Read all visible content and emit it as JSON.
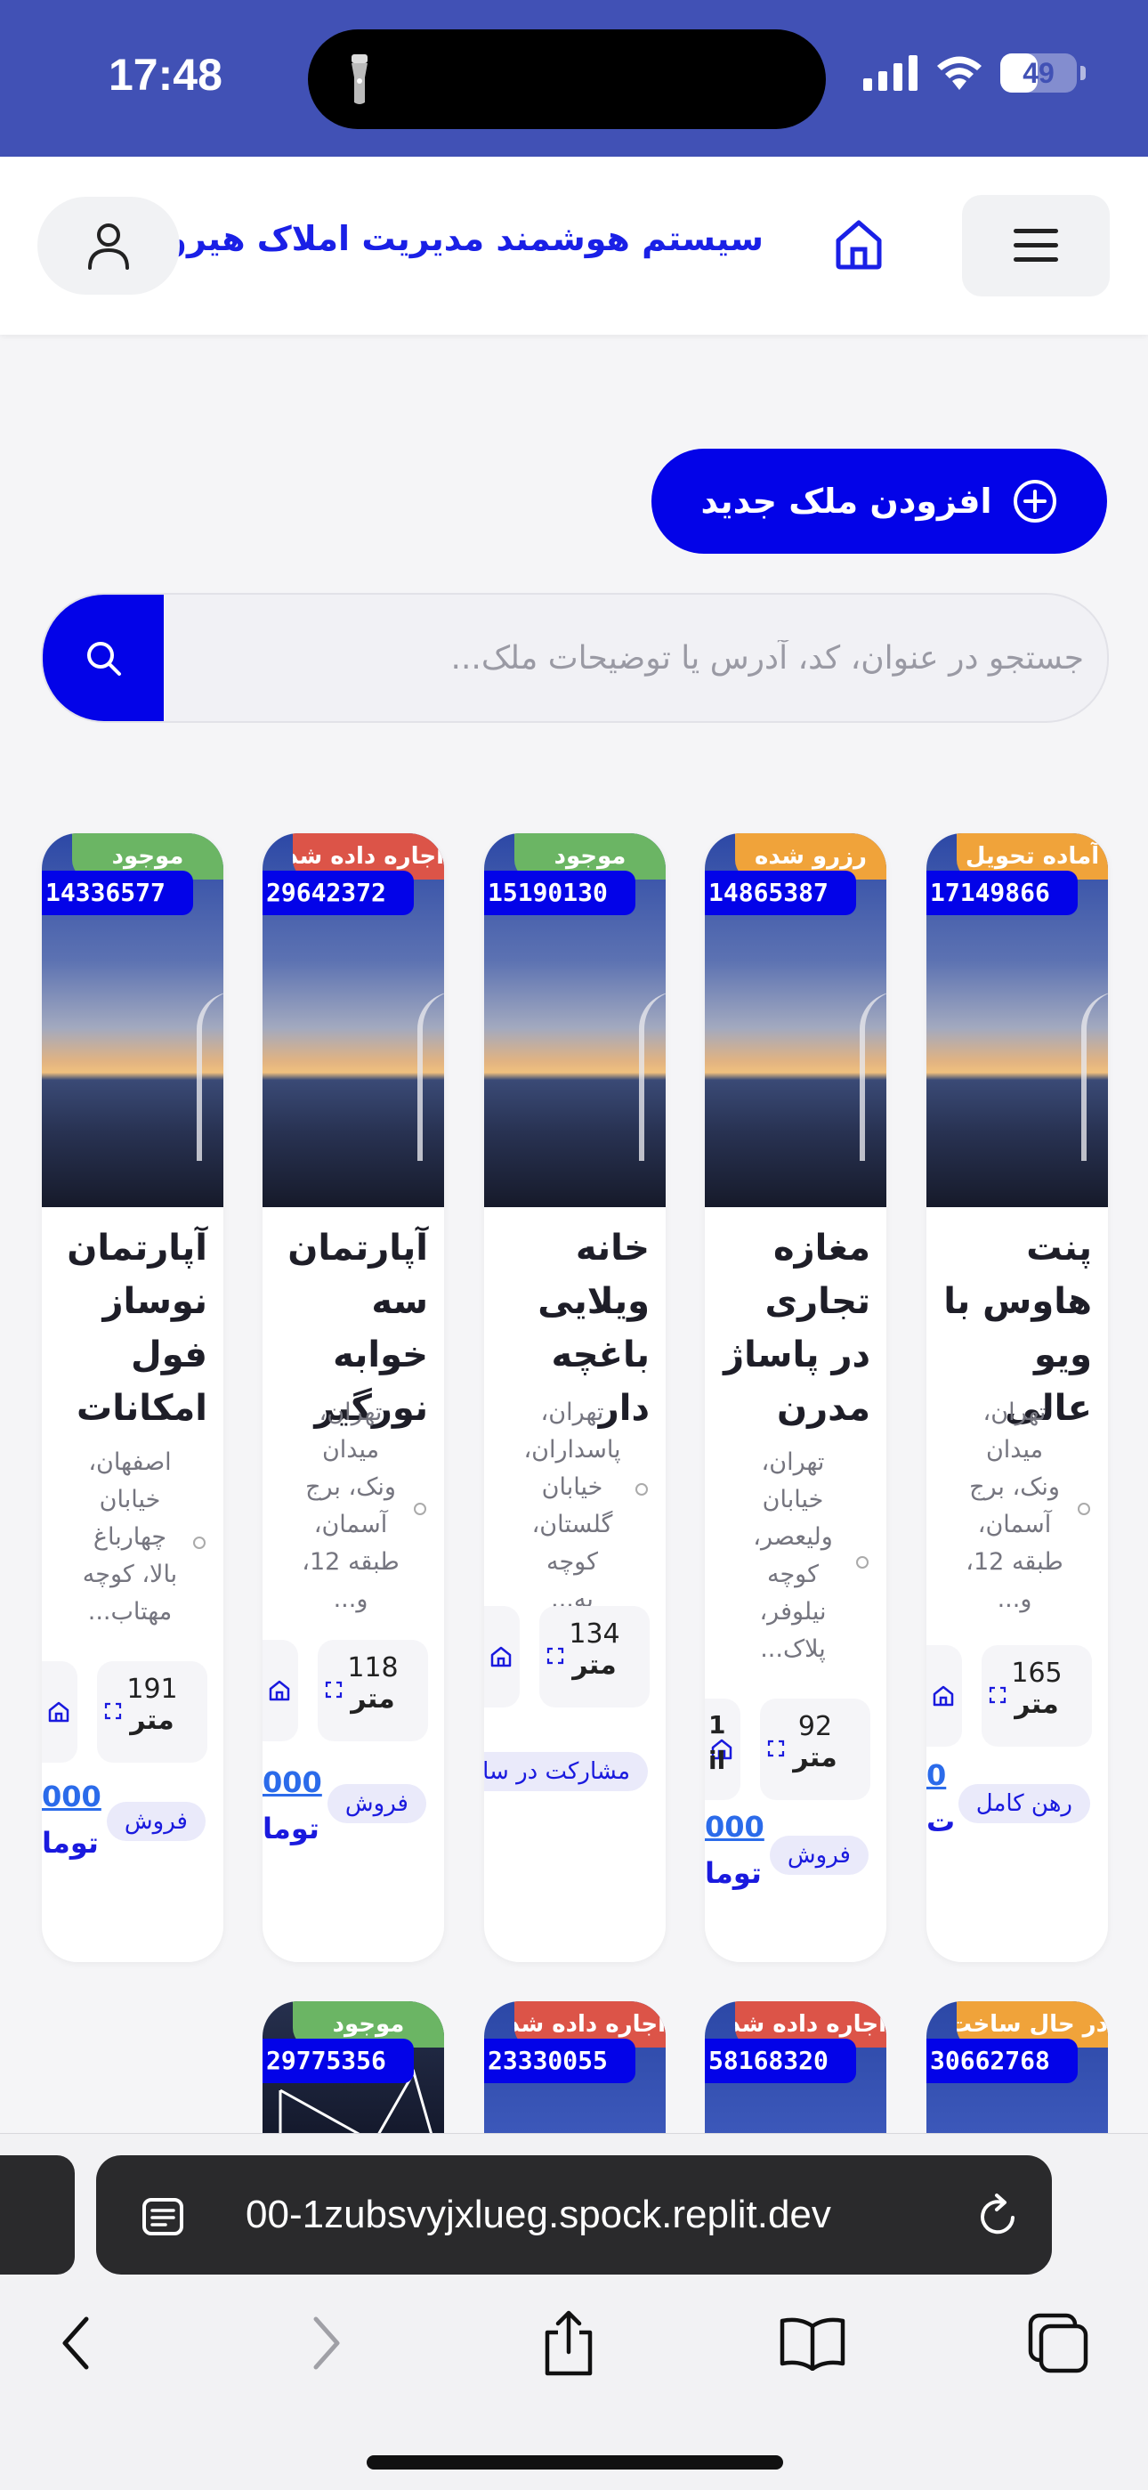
{
  "status_bar": {
    "time": "17:48",
    "battery": "49",
    "battery_level": 0.49
  },
  "header": {
    "title": "سیستم هوشمند مدیریت املاک هیرو"
  },
  "actions": {
    "add_label": "افزودن ملک جدید"
  },
  "search": {
    "placeholder": "جستجو در عنوان، کد، آدرس یا توضیحات ملک..."
  },
  "colors": {
    "primary": "#0303E8",
    "header": "#4151B5",
    "green": "#6BB564",
    "red": "#DC5448",
    "orange": "#F0A33A"
  },
  "cards": [
    {
      "status": "آماده تحویل",
      "status_color": "#F0A33A",
      "code": "17149866",
      "title": "پنت هاوس با ویو عالی",
      "address": "تهران، میدان ونک، برج آسمان، طبقه 12، و...",
      "area": "165",
      "unit": "متر",
      "tag": "رهن کامل",
      "price_a": "0",
      "price_b": "ت"
    },
    {
      "status": "رزرو شده",
      "status_color": "#F0A33A",
      "code": "14865387",
      "title": "مغازه تجاری در پاساژ مدرن",
      "address": "تهران، خیابان ولیعصر، کوچه نیلوفر، پلاک...",
      "area": "92",
      "unit": "متر",
      "tag": "فروش",
      "price_a": "000",
      "price_b": "توما",
      "extra": "1",
      "extra2": "il"
    },
    {
      "status": "موجود",
      "status_color": "#6BB564",
      "code": "15190130",
      "title": "خانه ویلایی باغچه دار",
      "address": "تهران، پاسداران، خیابان گلستان، کوچه به...",
      "area": "134",
      "unit": "متر",
      "tag": "مشارکت در ساخت"
    },
    {
      "status": "اجاره داده شده",
      "status_color": "#DC5448",
      "code": "29642372",
      "title": "آپارتمان سه خوابه نورگیر",
      "address": "تهران، میدان ونک، برج آسمان، طبقه 12، و...",
      "area": "118",
      "unit": "متر",
      "tag": "فروش",
      "price_a": "000",
      "price_b": "توما"
    },
    {
      "status": "موجود",
      "status_color": "#6BB564",
      "code": "14336577",
      "title": "آپارتمان نوساز فول امکانات",
      "address": "اصفهان، خیابان چهارباغ بالا، کوچه مهتاب...",
      "area": "191",
      "unit": "متر",
      "tag": "فروش",
      "price_a": "000",
      "price_b": "توما"
    }
  ],
  "cards_row2": [
    {
      "status": "در حال ساخت",
      "status_color": "#F0A33A",
      "code": "30662768"
    },
    {
      "status": "اجاره داده شده",
      "status_color": "#DC5448",
      "code": "58168320"
    },
    {
      "status": "اجاره داده شده",
      "status_color": "#DC5448",
      "code": "23330055"
    },
    {
      "status": "موجود",
      "status_color": "#6BB564",
      "code": "29775356"
    }
  ],
  "browser": {
    "url": "00-1zubsvyjxlueg.spock.replit.dev"
  }
}
